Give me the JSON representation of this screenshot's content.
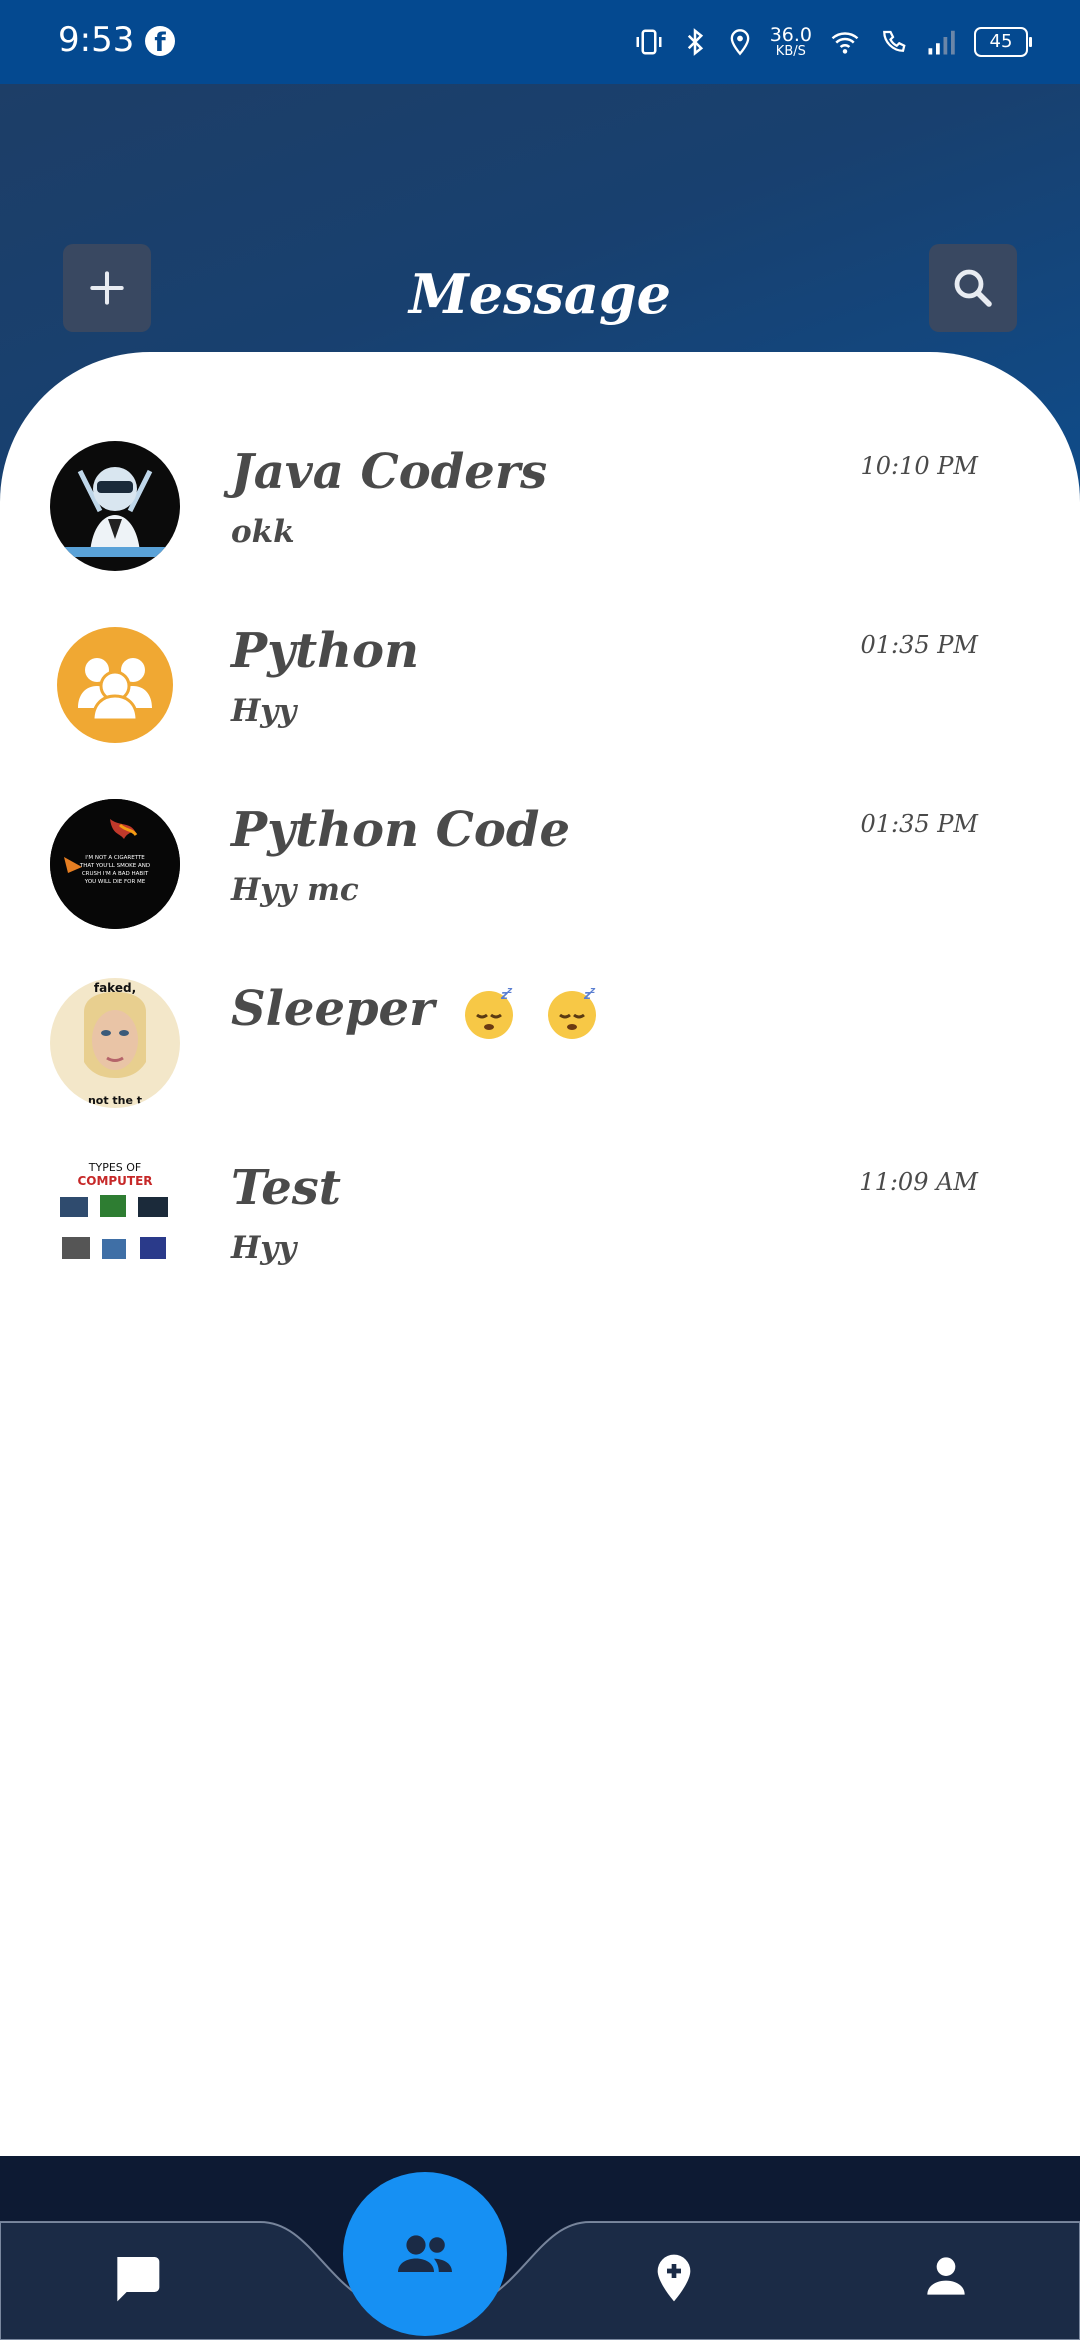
{
  "status_bar": {
    "time": "9:53",
    "facebook_icon": "facebook-icon",
    "net_speed_value": "36.0",
    "net_speed_unit": "KB/S",
    "battery": "45"
  },
  "header": {
    "title": "Message",
    "add_icon": "plus-icon",
    "search_icon": "search-icon",
    "bg_color": "#18406f"
  },
  "chats": [
    {
      "name": "Java Coders",
      "message": "okk",
      "time": "10:10 PM",
      "avatar": "gamer-avatar"
    },
    {
      "name": "Python",
      "message": "Hyy",
      "time": "01:35 PM",
      "avatar": "group-placeholder-avatar"
    },
    {
      "name": "Python Code",
      "message": "Hyy mc",
      "time": "01:35 PM",
      "avatar": "dark-text-avatar"
    },
    {
      "name": "Sleeper",
      "name_emoji": "😴😴",
      "message": "",
      "time": "",
      "avatar": "portrait-avatar"
    },
    {
      "name": "Test",
      "message": "Hyy",
      "time": "11:09 AM",
      "avatar": "computer-types-avatar"
    }
  ],
  "avatar_texts": {
    "python_code": "I'M NOT A CIGARETTE THAT YOU'LL SMOKE AND CRUSH I'M A BAD HABIT YOU WILL DIE FOR ME",
    "sleeper_top": "faked,",
    "sleeper_bottom": "not the t",
    "test_line1": "TYPES OF",
    "test_line2": "COMPUTER"
  },
  "bottom_nav": {
    "items": [
      "chat-icon",
      "group-icon",
      "add-location-icon",
      "person-icon"
    ],
    "active": "group-icon",
    "accent": "#1690f3",
    "bg_color": "#1b2b46"
  }
}
